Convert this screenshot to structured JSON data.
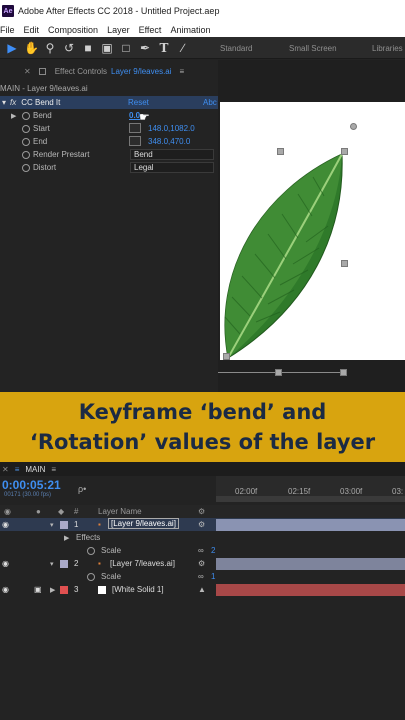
{
  "window": {
    "app_badge": "Ae",
    "title": "Adobe After Effects CC 2018 - Untitled Project.aep"
  },
  "menu": [
    "File",
    "Edit",
    "Composition",
    "Layer",
    "Effect",
    "Animation"
  ],
  "workspaces": [
    "Standard",
    "Small Screen",
    "Libraries"
  ],
  "effect_controls": {
    "tab_label": "Effect Controls",
    "tab_layer": "Layer 9/leaves.ai",
    "breadcrumb": "MAIN - Layer 9/leaves.ai",
    "effect_name": "CC Bend It",
    "reset": "Reset",
    "about": "Abc",
    "props": [
      {
        "name": "Bend",
        "value": "0.0"
      },
      {
        "name": "Start",
        "value": "148.0,1082.0"
      },
      {
        "name": "End",
        "value": "348.0,470.0"
      },
      {
        "name": "Render Prestart",
        "value": "Bend"
      },
      {
        "name": "Distort",
        "value": "Legal"
      }
    ]
  },
  "banner": {
    "line1": "Keyframe ‘bend’ and",
    "line2": "‘Rotation’ values of the layer"
  },
  "timeline": {
    "comp_tab": "MAIN",
    "timecode": "0:00:05:21",
    "timecode_sub": "00171 (30.00 fps)",
    "search_placeholder": "ρ•",
    "col_num": "#",
    "col_layer_name": "Layer Name",
    "ruler": [
      "02:00f",
      "02:15f",
      "03:00f",
      "03:"
    ],
    "layers": [
      {
        "num": "1",
        "name": "[Layer 9/leaves.ai]",
        "color": "#a9a9c8"
      },
      {
        "child": "Effects"
      },
      {
        "child": "Scale",
        "value": "2"
      },
      {
        "num": "2",
        "name": "[Layer 7/leaves.ai]",
        "color": "#a9a9c8"
      },
      {
        "child": "Scale",
        "value": "1"
      },
      {
        "num": "3",
        "name": "[White Solid 1]",
        "color": "#e05050"
      }
    ]
  },
  "colors": {
    "accent": "#3f8ef0",
    "banner": "#d8a40f",
    "banner_text": "#1b2a44",
    "leaf_dark": "#2f7a2a",
    "leaf_light": "#55a544"
  }
}
